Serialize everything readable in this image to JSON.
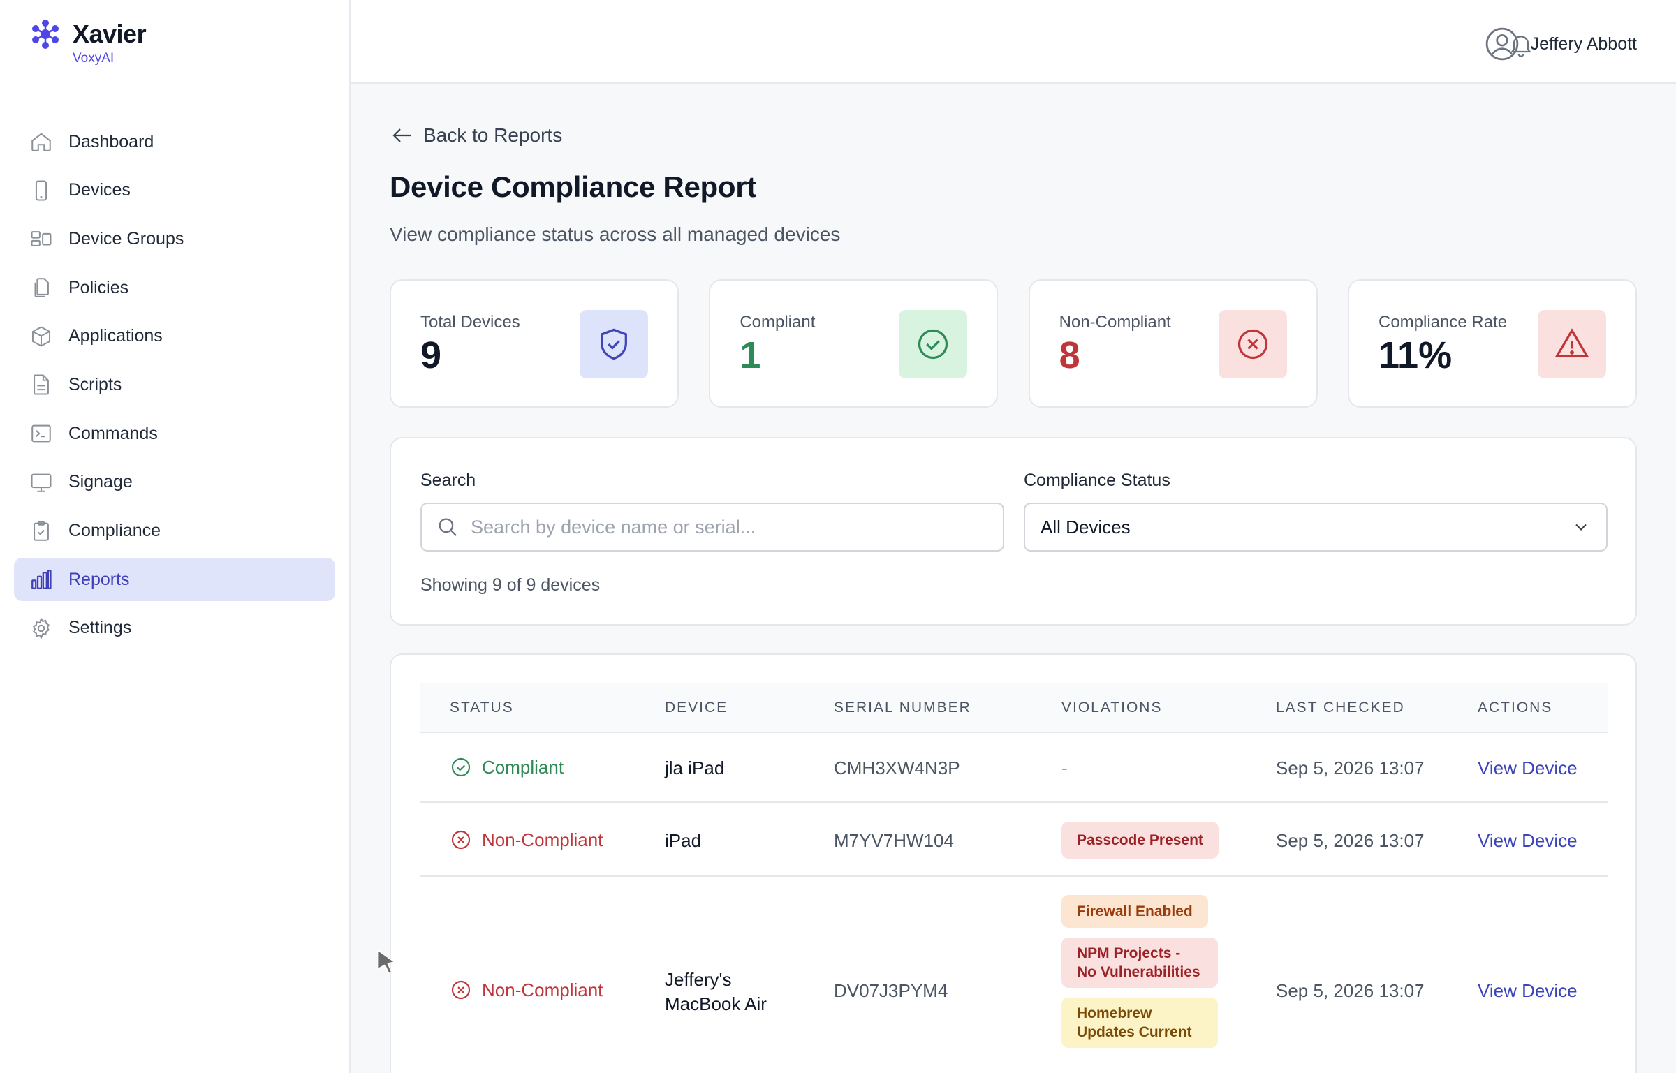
{
  "brand": {
    "name": "Xavier",
    "subtitle": "VoxyAI"
  },
  "sidebar": {
    "items": [
      {
        "label": "Dashboard",
        "icon": "home-icon",
        "active": false
      },
      {
        "label": "Devices",
        "icon": "phone-icon",
        "active": false
      },
      {
        "label": "Device Groups",
        "icon": "device-groups-icon",
        "active": false
      },
      {
        "label": "Policies",
        "icon": "policies-icon",
        "active": false
      },
      {
        "label": "Applications",
        "icon": "cube-icon",
        "active": false
      },
      {
        "label": "Scripts",
        "icon": "file-icon",
        "active": false
      },
      {
        "label": "Commands",
        "icon": "terminal-icon",
        "active": false
      },
      {
        "label": "Signage",
        "icon": "monitor-icon",
        "active": false
      },
      {
        "label": "Compliance",
        "icon": "clipboard-check-icon",
        "active": false
      },
      {
        "label": "Reports",
        "icon": "bar-chart-icon",
        "active": true
      },
      {
        "label": "Settings",
        "icon": "gear-icon",
        "active": false
      }
    ]
  },
  "header": {
    "user_name": "Jeffery Abbott"
  },
  "main": {
    "back_label": "Back to Reports",
    "title": "Device Compliance Report",
    "subtitle": "View compliance status across all managed devices"
  },
  "stats": [
    {
      "label": "Total Devices",
      "value": "9",
      "icon": "shield-check-icon",
      "color": "#111827",
      "bg": "#dde3fb",
      "icon_color": "#3f46b8"
    },
    {
      "label": "Compliant",
      "value": "1",
      "icon": "check-circle-icon",
      "color": "#2e8b57",
      "bg": "#d8f3df",
      "icon_color": "#2e8b57"
    },
    {
      "label": "Non-Compliant",
      "value": "8",
      "icon": "x-circle-icon",
      "color": "#c03538",
      "bg": "#fbe0e0",
      "icon_color": "#c03538"
    },
    {
      "label": "Compliance Rate",
      "value": "11%",
      "icon": "warning-triangle-icon",
      "color": "#111827",
      "bg": "#fbe0e0",
      "icon_color": "#c03538"
    }
  ],
  "filters": {
    "search_label": "Search",
    "search_placeholder": "Search by device name or serial...",
    "status_label": "Compliance Status",
    "status_selected": "All Devices",
    "showing": "Showing 9 of 9 devices"
  },
  "table": {
    "headers": [
      "STATUS",
      "DEVICE",
      "SERIAL NUMBER",
      "VIOLATIONS",
      "LAST CHECKED",
      "ACTIONS"
    ],
    "rows": [
      {
        "status": "Compliant",
        "device": "jla iPad",
        "serial": "CMH3XW4N3P",
        "violations": [],
        "no_violations": "-",
        "last_checked": "Sep 5, 2026 13:07",
        "action": "View Device"
      },
      {
        "status": "Non-Compliant",
        "device": "iPad",
        "serial": "M7YV7HW104",
        "violations": [
          "Passcode Present"
        ],
        "last_checked": "Sep 5, 2026 13:07",
        "action": "View Device"
      },
      {
        "status": "Non-Compliant",
        "device": "Jeffery's MacBook Air",
        "serial": "DV07J3PYM4",
        "violations": [
          "Firewall Enabled",
          "NPM Projects - No Vulnerabilities",
          "Homebrew Updates Current"
        ],
        "last_checked": "Sep 5, 2026 13:07",
        "action": "View Device"
      }
    ]
  },
  "colors": {
    "accent": "#4f46e5",
    "active_bg": "#e0e4fb",
    "success": "#2e8b57",
    "danger": "#c03538"
  }
}
